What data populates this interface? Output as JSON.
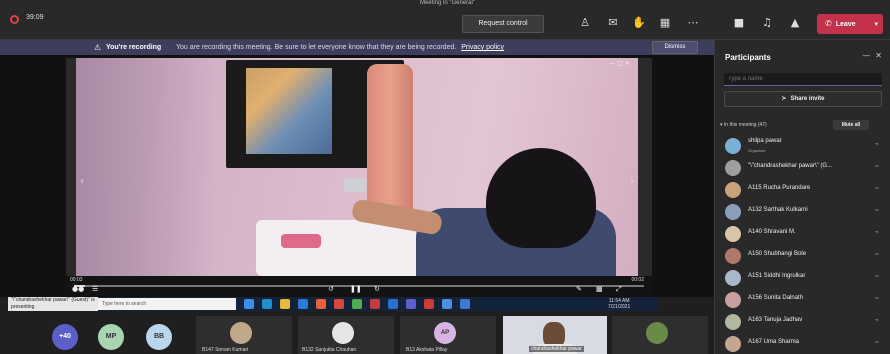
{
  "window_title": "Meeting in \"General\"",
  "topbar": {
    "timer": "39:09",
    "request_control_label": "Request control",
    "leave_label": "Leave"
  },
  "banner": {
    "title": "You're recording",
    "message": "You are recording this meeting. Be sure to let everyone know that they are being recorded.",
    "link": "Privacy policy",
    "dismiss_label": "Dismiss"
  },
  "player": {
    "time_elapsed": "00:03",
    "time_total": "00:02",
    "progress": 0.02
  },
  "taskbar": {
    "presenter_label": "\"\\\"chandrashekhar pawar\\\" (Guest)\" is presenting",
    "search_placeholder": "Type here to search",
    "clock_time": "11:54 AM",
    "clock_date": "7/21/2021"
  },
  "bottom": {
    "overflow_count": "+40",
    "chips": [
      {
        "initials": "MP",
        "color": "#a8d5b0"
      },
      {
        "initials": "BB",
        "color": "#b9d6ec"
      }
    ],
    "tiles": [
      {
        "name": "B147 Sonam Kumari"
      },
      {
        "name": "B132 Sanjukta Chauhan"
      },
      {
        "name": "B13 Akshata Pillay",
        "initials": "AP"
      },
      {
        "name": "chandrashekhar pawar"
      }
    ]
  },
  "panel": {
    "title": "Participants",
    "search_placeholder": "Type a name",
    "share_invite_label": "Share invite",
    "section_label": "In this meeting (47)",
    "mute_all_label": "Mute all",
    "participants": [
      {
        "name": "shilpa pawar",
        "role": "Organizer",
        "color": "#7ab0d8"
      },
      {
        "name": "\"\\\"chandrashekhar pawar\\\" (G...",
        "role": "",
        "color": "#9e9e9e"
      },
      {
        "name": "A115 Rucha Purandare",
        "role": "",
        "color": "#c9a27a"
      },
      {
        "name": "A132 Sarthak Kulkarni",
        "role": "",
        "color": "#8aa0b8"
      },
      {
        "name": "A140 Shravani M.",
        "role": "",
        "color": "#d8c4a8"
      },
      {
        "name": "A150 Shubhangi Bole",
        "role": "",
        "color": "#b07a6a"
      },
      {
        "name": "A151 Siddhi Ingrulkar",
        "role": "",
        "color": "#a8b8c8"
      },
      {
        "name": "A156 Sunita Dalnath",
        "role": "",
        "color": "#c8a0a0"
      },
      {
        "name": "A163 Tanuja Jadhav",
        "role": "",
        "color": "#b0b8a0"
      },
      {
        "name": "A167 Uma Sharma",
        "role": "",
        "color": "#c0a890"
      }
    ]
  }
}
